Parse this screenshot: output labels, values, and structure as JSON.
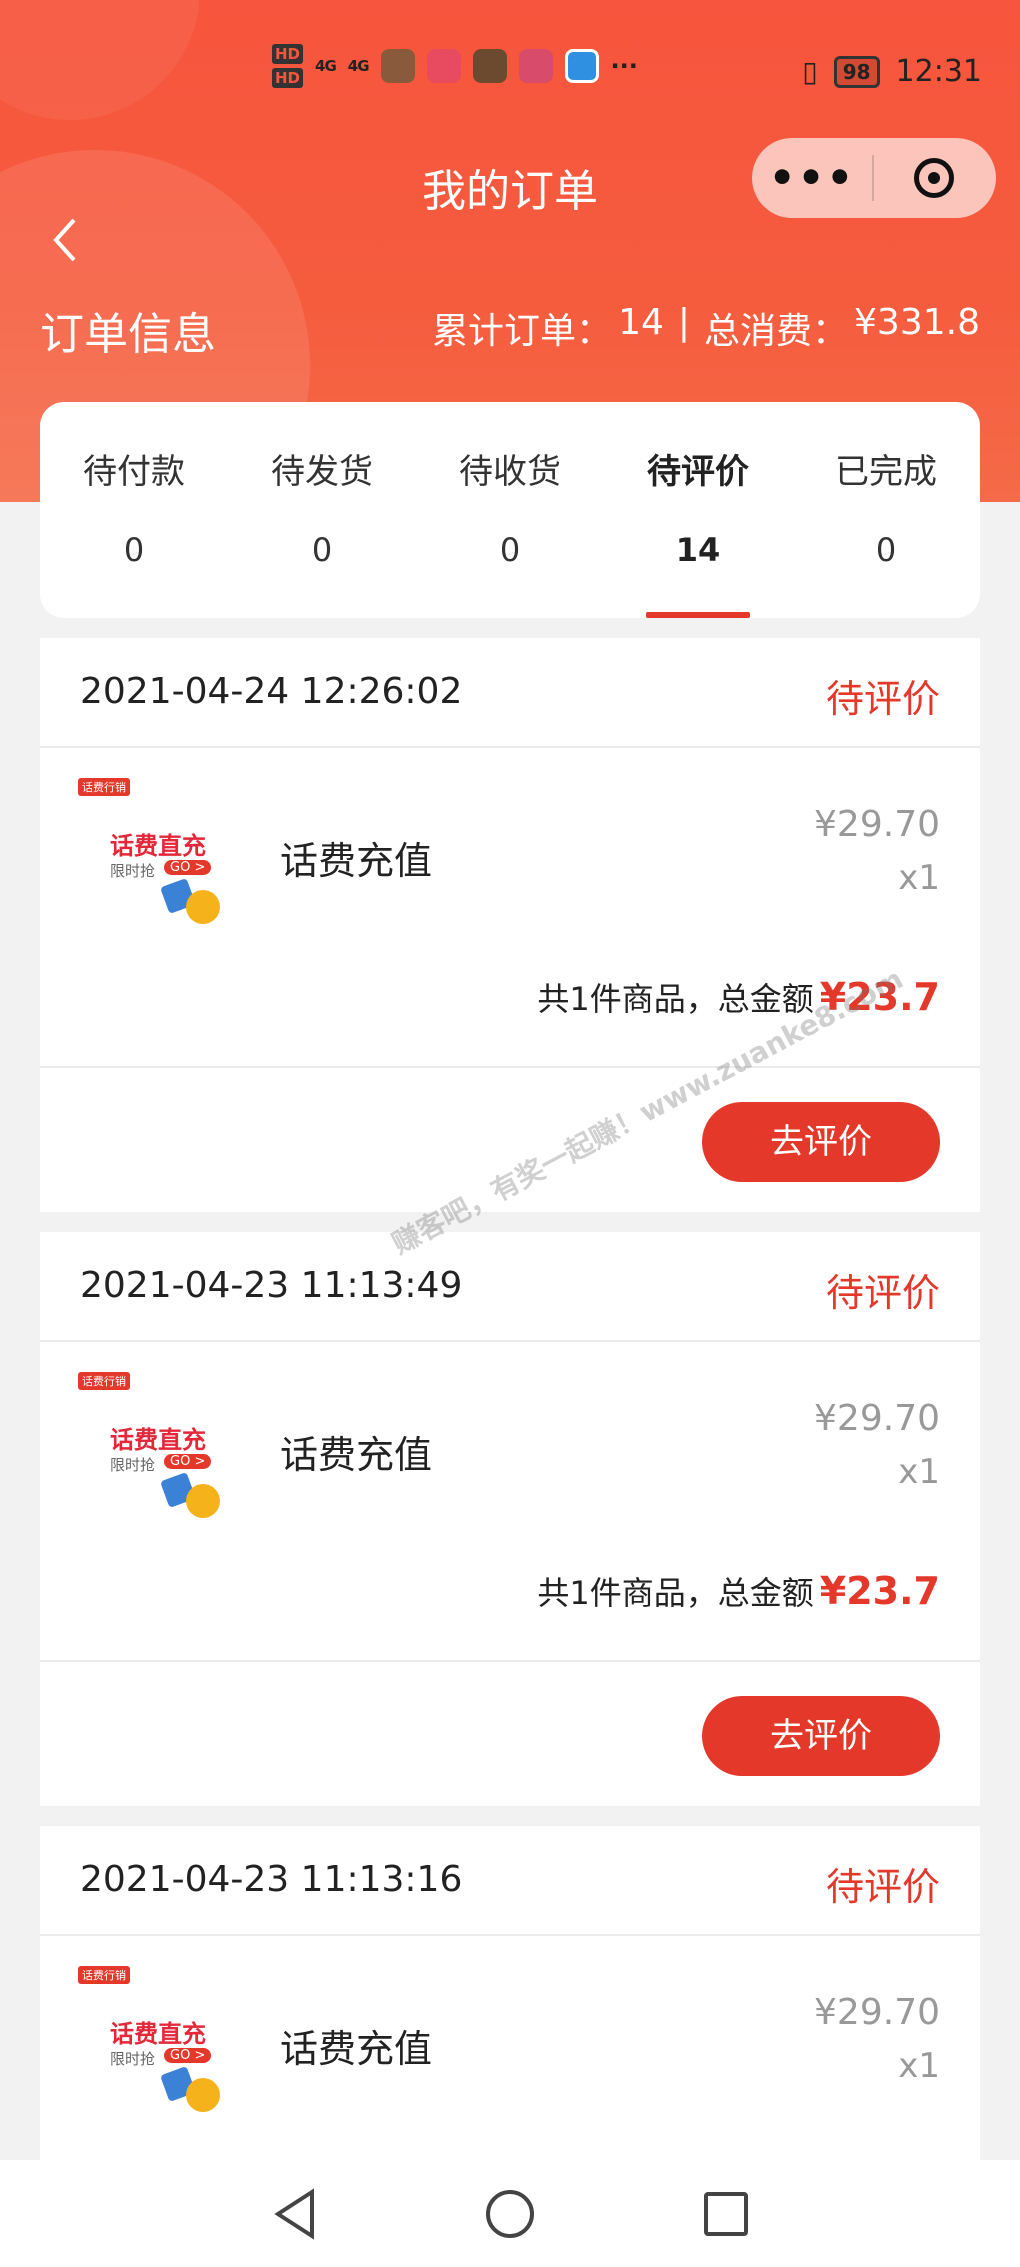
{
  "status_bar": {
    "hd1": "HD",
    "hd2": "HD",
    "net1": "4G",
    "net2": "4G",
    "more": "···",
    "battery": "98",
    "time": "12:31"
  },
  "nav": {
    "title": "我的订单",
    "back_icon": "chevron-left-icon",
    "more_label": "•••",
    "close_icon": "target-icon"
  },
  "summary": {
    "label": "订单信息",
    "total_orders_label": "累计订单：",
    "total_orders": "14",
    "separator": "|",
    "total_spend_label": "总消费：",
    "total_spend": "¥331.8"
  },
  "tabs": [
    {
      "label": "待付款",
      "count": "0"
    },
    {
      "label": "待发货",
      "count": "0"
    },
    {
      "label": "待收货",
      "count": "0"
    },
    {
      "label": "待评价",
      "count": "14",
      "active": true
    },
    {
      "label": "已完成",
      "count": "0"
    }
  ],
  "orders": [
    {
      "time": "2021-04-24 12:26:02",
      "status": "待评价",
      "thumb_tag": "话费行销",
      "thumb_title": "话费直充",
      "thumb_sub": "限时抢",
      "thumb_go": "GO >",
      "product": "话费充值",
      "price": "¥29.70",
      "qty": "x1",
      "total_label": "共1件商品，总金额",
      "total": "¥23.7",
      "action": "去评价"
    },
    {
      "time": "2021-04-23 11:13:49",
      "status": "待评价",
      "thumb_tag": "话费行销",
      "thumb_title": "话费直充",
      "thumb_sub": "限时抢",
      "thumb_go": "GO >",
      "product": "话费充值",
      "price": "¥29.70",
      "qty": "x1",
      "total_label": "共1件商品，总金额",
      "total": "¥23.7",
      "action": "去评价"
    },
    {
      "time": "2021-04-23 11:13:16",
      "status": "待评价",
      "thumb_tag": "话费行销",
      "thumb_title": "话费直充",
      "thumb_sub": "限时抢",
      "thumb_go": "GO >",
      "product": "话费充值",
      "price": "¥29.70",
      "qty": "x1"
    }
  ],
  "watermark": "赚客吧，有奖一起赚！www.zuanke8.com",
  "colors": {
    "header": "#f7553d",
    "accent": "#e4382a",
    "background": "#f2f2f2"
  }
}
